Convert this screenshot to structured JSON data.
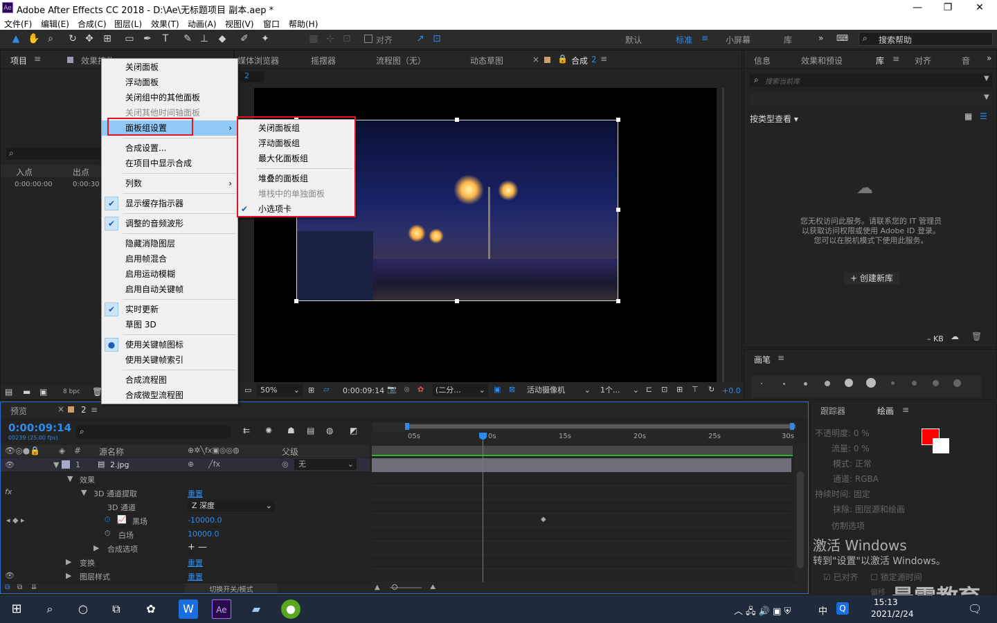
{
  "titlebar": {
    "title": "Adobe After Effects CC 2018 - D:\\Ae\\无标题项目 副本.aep *",
    "app_icon": "Ae",
    "minimize": "—",
    "maximize": "❐",
    "close": "✕"
  },
  "menubar": {
    "items": [
      "文件(F)",
      "编辑(E)",
      "合成(C)",
      "图层(L)",
      "效果(T)",
      "动画(A)",
      "视图(V)",
      "窗口",
      "帮助(H)"
    ]
  },
  "toolbar": {
    "snap_label": "对齐",
    "workspaces": [
      "默认",
      "标准",
      "小屏幕",
      "库"
    ],
    "active_workspace": "标准",
    "search_placeholder": "搜索帮助"
  },
  "project_panel": {
    "tabs": [
      "项目",
      "效果控件"
    ],
    "col_in": "入点",
    "col_out": "出点",
    "in_value": "0:00:00:00",
    "out_value": "0:00:30",
    "bpc": "8 bpc"
  },
  "viewer_tabs": {
    "tabs": [
      "媒体浏览器",
      "摇摆器",
      "流程图（无）",
      "动态草图",
      "合成"
    ],
    "comp_name": "2",
    "comp_tab_label": "合成 2"
  },
  "viewer_footer": {
    "zoom": "50%",
    "timecode": "0:00:09:14",
    "resolution": "(二分...",
    "camera": "活动摄像机",
    "views": "1个...",
    "exposure": "+0.0"
  },
  "context_menu": {
    "items": [
      {
        "label": "关闭面板",
        "disabled": false
      },
      {
        "label": "浮动面板",
        "disabled": false
      },
      {
        "label": "关闭组中的其他面板",
        "disabled": false
      },
      {
        "label": "关闭其他时间轴面板",
        "disabled": true
      },
      {
        "label": "面板组设置",
        "disabled": false,
        "submenu": true
      },
      {
        "label": "合成设置...",
        "disabled": false
      },
      {
        "label": "在项目中显示合成",
        "disabled": false
      },
      {
        "label": "列数",
        "disabled": false,
        "submenu": true
      },
      {
        "label": "显示缓存指示器",
        "checked": true
      },
      {
        "label": "调整的音频波形",
        "checked": true
      },
      {
        "label": "隐藏消隐图层"
      },
      {
        "label": "启用帧混合"
      },
      {
        "label": "启用运动模糊"
      },
      {
        "label": "启用自动关键帧"
      },
      {
        "label": "实时更新",
        "checked": true
      },
      {
        "label": "草图 3D"
      },
      {
        "label": "使用关键帧图标",
        "radio": true
      },
      {
        "label": "使用关键帧索引"
      },
      {
        "label": "合成流程图"
      },
      {
        "label": "合成微型流程图"
      }
    ]
  },
  "submenu": {
    "items": [
      {
        "label": "关闭面板组",
        "disabled": false
      },
      {
        "label": "浮动面板组",
        "disabled": false
      },
      {
        "label": "最大化面板组",
        "disabled": false
      },
      {
        "label": "堆叠的面板组",
        "disabled": false
      },
      {
        "label": "堆栈中的单独面板",
        "disabled": true
      },
      {
        "label": "小选项卡",
        "disabled": false,
        "checked": true
      }
    ]
  },
  "right_panel": {
    "tabs": [
      "信息",
      "效果和预设",
      "库",
      "对齐",
      "音"
    ],
    "search_placeholder": "搜索当前库",
    "view_by": "按类型查看",
    "message": "您无权访问此服务。请联系您的 IT 管理员以获取访问权限或使用 Adobe ID 登录。您可以在脱机模式下使用此服务。",
    "create_button": "+ 创建新库",
    "kb": "– KB"
  },
  "brush_panel": {
    "tab": "画笔",
    "sizes": [
      "1",
      "3",
      "5",
      "9",
      "13",
      "19",
      "5",
      "9",
      "13",
      "17"
    ]
  },
  "paint_panel": {
    "tabs": [
      "跟踪器",
      "绘画"
    ],
    "rows": [
      {
        "label": "不透明度:",
        "value": "0 %"
      },
      {
        "label": "流量:",
        "value": "0 %"
      },
      {
        "label": "模式:",
        "value": "正常"
      },
      {
        "label": "通道:",
        "value": "RGBA"
      },
      {
        "label": "持续时间:",
        "value": "固定"
      },
      {
        "label": "抹除:",
        "value": "图层源和绘画"
      }
    ],
    "clone": "仿制选项",
    "aligned": "已对齐",
    "lock_time": "锁定源时间",
    "offset": "偏移",
    "fg_color": "#ff0000",
    "bg_color": "#ffffff"
  },
  "timeline": {
    "tabs": [
      "预览",
      "2"
    ],
    "timecode": "0:00:09:14",
    "frames": "00239 (25.00 fps)",
    "col_source": "源名称",
    "col_parent": "父级",
    "layer_num": "1",
    "layer_name": "2.jpg",
    "parent_value": "无",
    "ruler": [
      "05s",
      "0s",
      "15s",
      "20s",
      "25s",
      "30s"
    ],
    "rows": [
      {
        "label": "效果",
        "value": ""
      },
      {
        "label": "3D 通道提取",
        "value": "重置"
      },
      {
        "label": "3D 通道",
        "value": "Z 深度"
      },
      {
        "label": "黑场",
        "value": "-10000.0"
      },
      {
        "label": "白场",
        "value": "10000.0"
      },
      {
        "label": "合成选项",
        "value": "+ —"
      },
      {
        "label": "变换",
        "value": "重置"
      },
      {
        "label": "图层样式",
        "value": "重置"
      }
    ],
    "switches_label": "切换开关/模式"
  },
  "watermark": {
    "line1": "激活 Windows",
    "line2": "转到\"设置\"以激活 Windows。",
    "brand": "最需教育"
  },
  "taskbar": {
    "time": "15:13",
    "date": "2021/2/24",
    "ime": "中"
  }
}
